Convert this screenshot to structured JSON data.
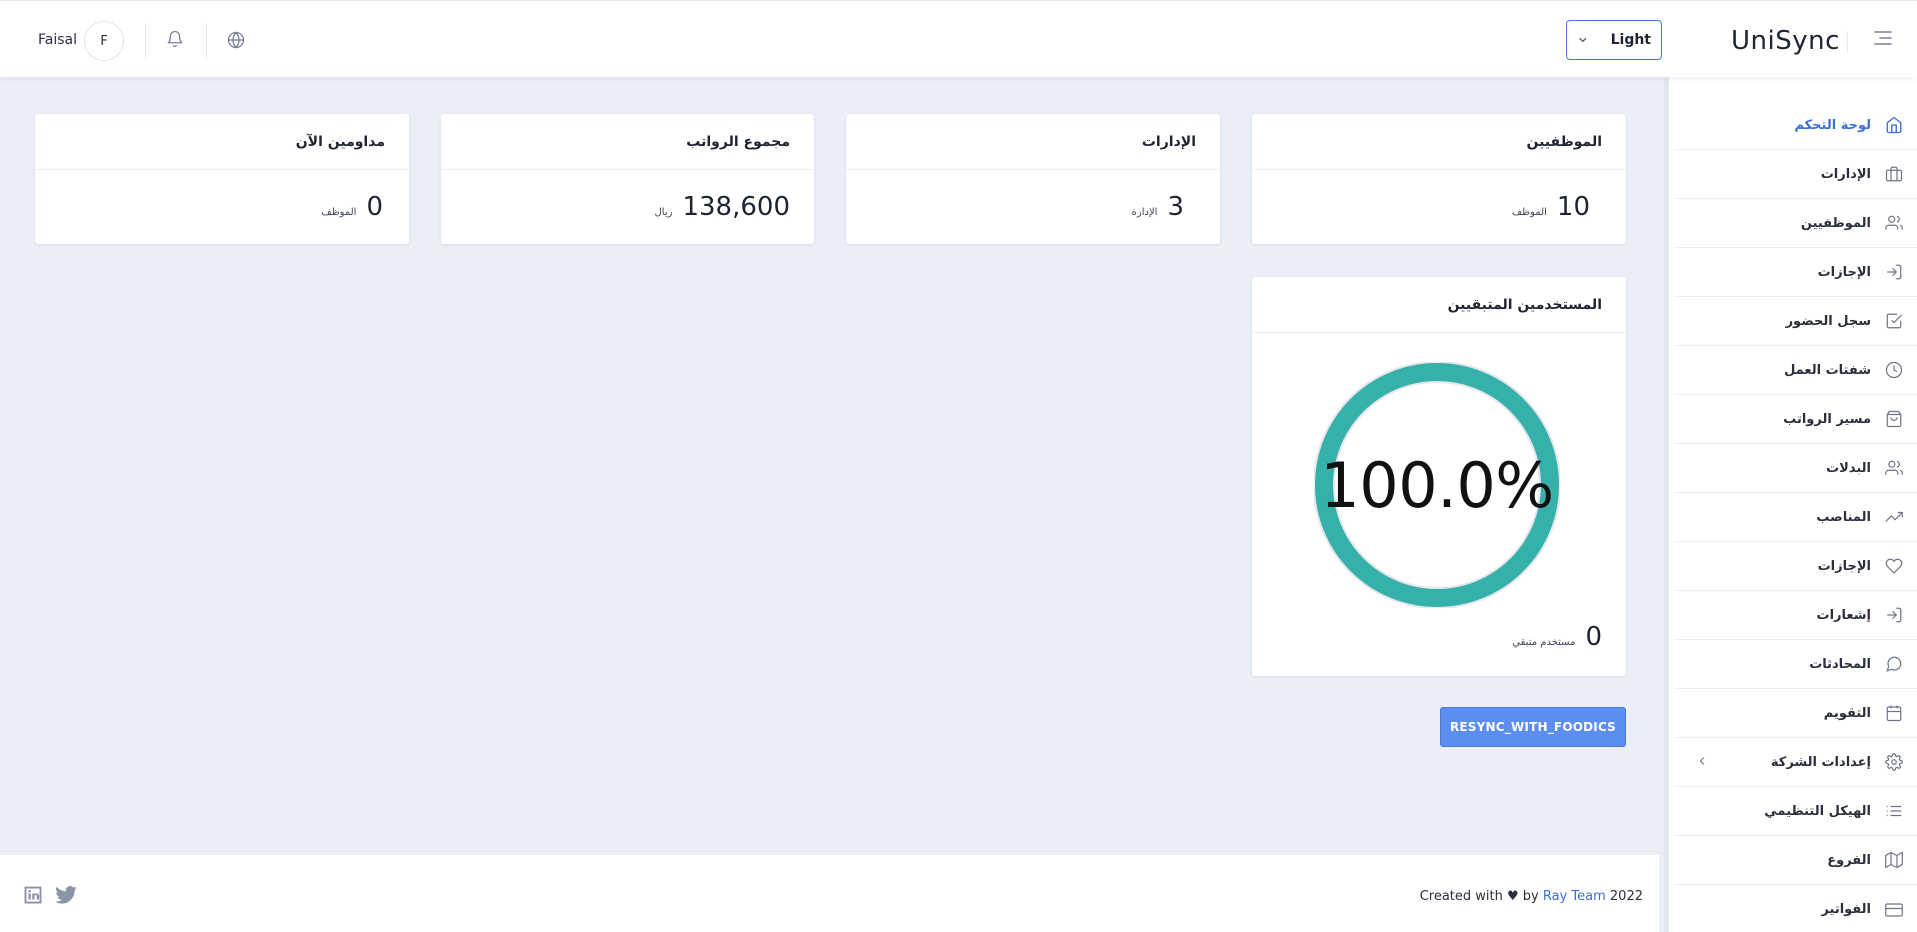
{
  "header": {
    "brand": "UniSync",
    "theme_selector": {
      "selected": "Light"
    },
    "user": {
      "name": "Faisal",
      "initial": "F"
    }
  },
  "sidebar": {
    "items": [
      {
        "label": "لوحة التحكم",
        "icon": "home-icon",
        "active": true
      },
      {
        "label": "الإدارات",
        "icon": "briefcase-icon"
      },
      {
        "label": "الموظفيين",
        "icon": "users-icon"
      },
      {
        "label": "الإجازات",
        "icon": "log-in-icon"
      },
      {
        "label": "سجل الحضور",
        "icon": "check-square-icon"
      },
      {
        "label": "شفتات العمل",
        "icon": "clock-icon"
      },
      {
        "label": "مسير الرواتب",
        "icon": "shopping-bag-icon"
      },
      {
        "label": "البدلات",
        "icon": "users-icon"
      },
      {
        "label": "المناصب",
        "icon": "trending-up-icon"
      },
      {
        "label": "الإجازات",
        "icon": "heart-icon"
      },
      {
        "label": "إشعارات",
        "icon": "log-in-icon"
      },
      {
        "label": "المحادثات",
        "icon": "message-circle-icon"
      },
      {
        "label": "التقويم",
        "icon": "calendar-icon"
      },
      {
        "label": "إعدادات الشركة",
        "icon": "settings-icon",
        "expandable": true
      },
      {
        "label": "الهيكل التنظيمي",
        "icon": "list-icon"
      },
      {
        "label": "الفروع",
        "icon": "map-icon"
      },
      {
        "label": "الفواتير",
        "icon": "credit-card-icon"
      }
    ]
  },
  "stats": {
    "employees": {
      "title": "الموظفيين",
      "value": "10",
      "unit": "الموظف"
    },
    "departments": {
      "title": "الإدارات",
      "value": "3",
      "unit": "الإدارة"
    },
    "salaries": {
      "title": "مجموع الرواتب",
      "value": "138,600",
      "unit": "ريال"
    },
    "working_now": {
      "title": "مداومين الآن",
      "value": "0",
      "unit": "الموظف"
    }
  },
  "remaining_users": {
    "title": "المستخدمين المتبقيين",
    "percent_label": "100.0%",
    "percent": 100,
    "value": "0",
    "unit": "مستخدم متبقي",
    "ring_color": "#35b0ab"
  },
  "actions": {
    "resync_label": "RESYNC_WITH_FOODICS"
  },
  "footer": {
    "credit_prefix": "Created with ♥ by",
    "team": "Ray Team",
    "year": "2022"
  },
  "colors": {
    "accent": "#3b6fd9",
    "button": "#5b8ef0",
    "background": "#ebeef7"
  }
}
